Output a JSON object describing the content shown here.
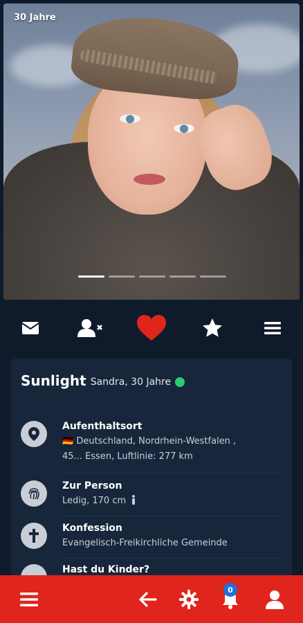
{
  "profile": {
    "age_badge": "30 Jahre",
    "nickname": "Sunlight",
    "subtitle": "Sandra, 30 Jahre",
    "online": true,
    "photo_count": 5,
    "active_photo": 1
  },
  "actions": [
    {
      "icon": "envelope-icon"
    },
    {
      "icon": "remove-friend-icon"
    },
    {
      "icon": "heart-icon"
    },
    {
      "icon": "star-icon"
    },
    {
      "icon": "menu-icon"
    }
  ],
  "details": {
    "location": {
      "label": "Aufenthaltsort",
      "line1": "🇩🇪 Deutschland, Nordrhein-Westfalen ,",
      "line2": "45... Essen,  Luftlinie: 277 km"
    },
    "person": {
      "label": "Zur Person",
      "value": "Ledig, 170 cm"
    },
    "confession": {
      "label": "Konfession",
      "value": "Evangelisch-Freikirchliche Gemeinde"
    },
    "children": {
      "label": "Hast du Kinder?"
    }
  },
  "bottom_nav": {
    "notification_count": "0"
  },
  "colors": {
    "background": "#0f1b2b",
    "card": "#17263a",
    "accent_red": "#e0251c",
    "online": "#2ecc71",
    "badge_blue": "#1f6fe0"
  }
}
